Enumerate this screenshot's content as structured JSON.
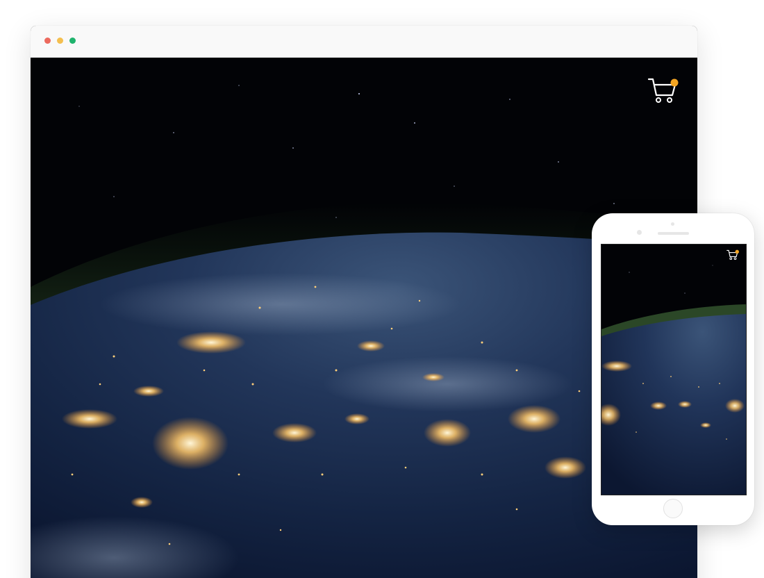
{
  "browser": {
    "window_controls": [
      {
        "name": "close",
        "color": "#ec6a5e"
      },
      {
        "name": "minimize",
        "color": "#f4bf4f"
      },
      {
        "name": "maximize",
        "color": "#1fb36d"
      }
    ],
    "hero": {
      "image": "earth-at-night-from-space",
      "cart": {
        "icon": "shopping-cart-icon",
        "badge_color": "#f5a623",
        "icon_color": "#ffffff"
      }
    }
  },
  "phone": {
    "hero": {
      "image": "earth-at-night-from-space",
      "cart": {
        "icon": "shopping-cart-icon",
        "badge_color": "#f5a623",
        "icon_color": "#ffffff"
      }
    }
  }
}
